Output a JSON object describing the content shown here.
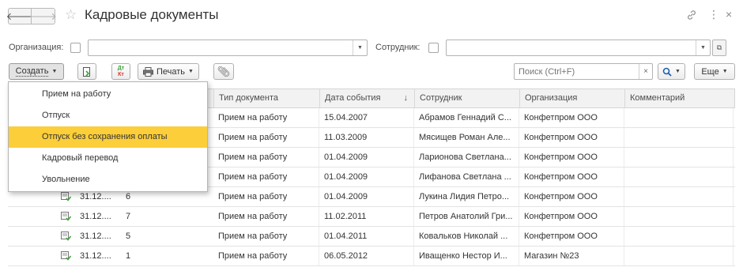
{
  "window": {
    "title": "Кадровые документы",
    "back_icon": "arrow-left-icon",
    "forward_icon": "arrow-right-icon",
    "favorite_icon": "star-icon"
  },
  "filters": {
    "organization_label": "Организация:",
    "organization_value": "",
    "employee_label": "Сотрудник:",
    "employee_value": ""
  },
  "toolbar": {
    "create_label": "Создать",
    "print_label": "Печать",
    "posting_icon_text_top": "Дт",
    "posting_icon_text_bottom": "Кт",
    "search_placeholder": "Поиск (Ctrl+F)",
    "more_label": "Еще"
  },
  "table": {
    "columns": [
      "Тип документа",
      "Дата события",
      "Сотрудник",
      "Организация",
      "Комментарий"
    ],
    "sort_indicator": "↓",
    "rows": [
      {
        "date": "",
        "number": "",
        "doc_type": "Прием на работу",
        "event_date": "15.04.2007",
        "employee": "Абрамов Геннадий С...",
        "org": "Конфетпром ООО",
        "comment": ""
      },
      {
        "date": "",
        "number": "",
        "doc_type": "Прием на работу",
        "event_date": "11.03.2009",
        "employee": "Мясищев Роман Але...",
        "org": "Конфетпром ООО",
        "comment": ""
      },
      {
        "date": "",
        "number": "",
        "doc_type": "Прием на работу",
        "event_date": "01.04.2009",
        "employee": "Ларионова Светлана...",
        "org": "Конфетпром ООО",
        "comment": ""
      },
      {
        "date": "",
        "number": "",
        "doc_type": "Прием на работу",
        "event_date": "01.04.2009",
        "employee": "Лифанова Светлана ...",
        "org": "Конфетпром ООО",
        "comment": ""
      },
      {
        "date": "31.12....",
        "number": "6",
        "doc_type": "Прием на работу",
        "event_date": "01.04.2009",
        "employee": "Лукина Лидия Петро...",
        "org": "Конфетпром ООО",
        "comment": ""
      },
      {
        "date": "31.12....",
        "number": "7",
        "doc_type": "Прием на работу",
        "event_date": "11.02.2011",
        "employee": "Петров Анатолий Гри...",
        "org": "Конфетпром ООО",
        "comment": ""
      },
      {
        "date": "31.12....",
        "number": "5",
        "doc_type": "Прием на работу",
        "event_date": "01.04.2011",
        "employee": "Ковальков Николай ...",
        "org": "Конфетпром ООО",
        "comment": ""
      },
      {
        "date": "31.12....",
        "number": "1",
        "doc_type": "Прием на работу",
        "event_date": "06.05.2012",
        "employee": "Иващенко Нестор И...",
        "org": "Магазин №23",
        "comment": ""
      }
    ]
  },
  "create_menu": {
    "items": [
      "Прием на работу",
      "Отпуск",
      "Отпуск без сохранения оплаты",
      "Кадровый перевод",
      "Увольнение"
    ],
    "selected_index": 2
  },
  "colors": {
    "highlight": "#fbce3a",
    "doc_icon_green": "#3fa33f"
  }
}
